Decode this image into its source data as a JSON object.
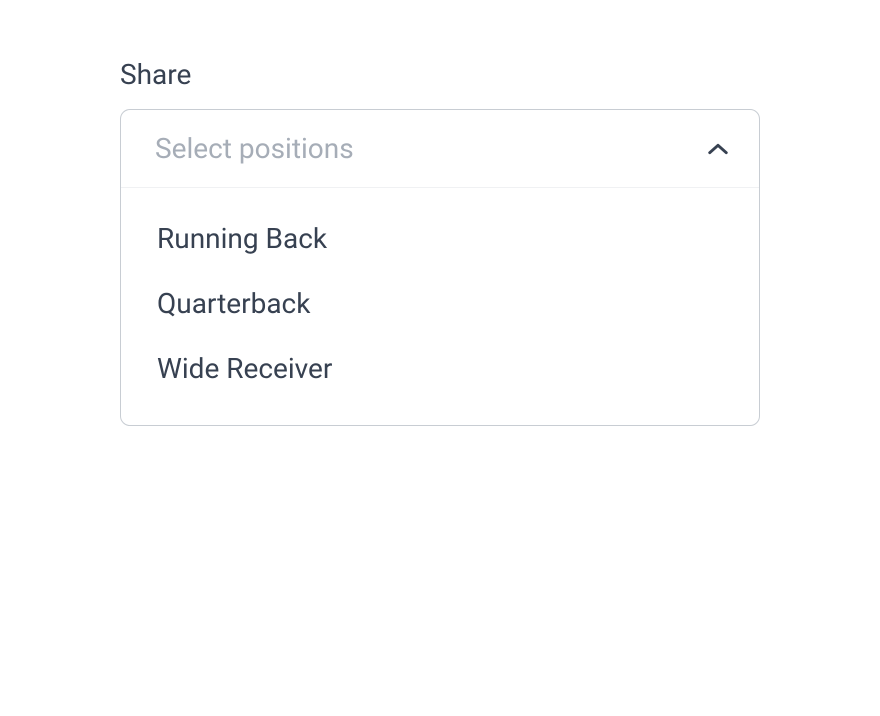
{
  "field": {
    "label": "Share",
    "placeholder": "Select positions",
    "expanded": true,
    "options": [
      {
        "label": "Running Back"
      },
      {
        "label": "Quarterback"
      },
      {
        "label": "Wide Receiver"
      }
    ]
  }
}
